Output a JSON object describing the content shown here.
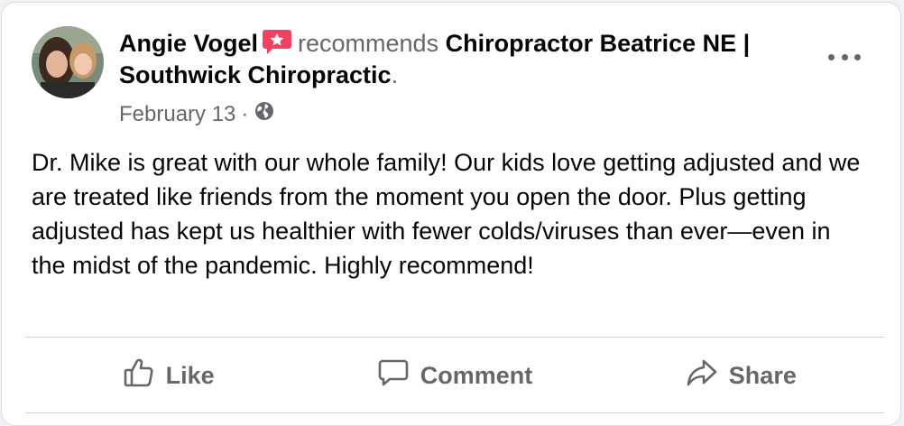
{
  "post": {
    "author": "Angie Vogel",
    "verb": "recommends",
    "page_name": "Chiropractor Beatrice NE | Southwick Chiropractic",
    "period": ".",
    "date": "February 13",
    "separator": "·",
    "privacy_icon": "globe-icon",
    "badge_icon": "recommendation-star-icon",
    "badge_color": "#f3425f",
    "body": "Dr. Mike is great with our whole family! Our kids love getting adjusted and we are treated like friends from the moment you open the door. Plus getting adjusted has kept us healthier with fewer colds/viruses than ever—even in the midst of the pandemic. Highly recommend!"
  },
  "actions": {
    "like_label": "Like",
    "comment_label": "Comment",
    "share_label": "Share"
  },
  "colors": {
    "text": "#050505",
    "muted": "#65676b",
    "divider": "#ced0d4",
    "card_bg": "#ffffff"
  }
}
